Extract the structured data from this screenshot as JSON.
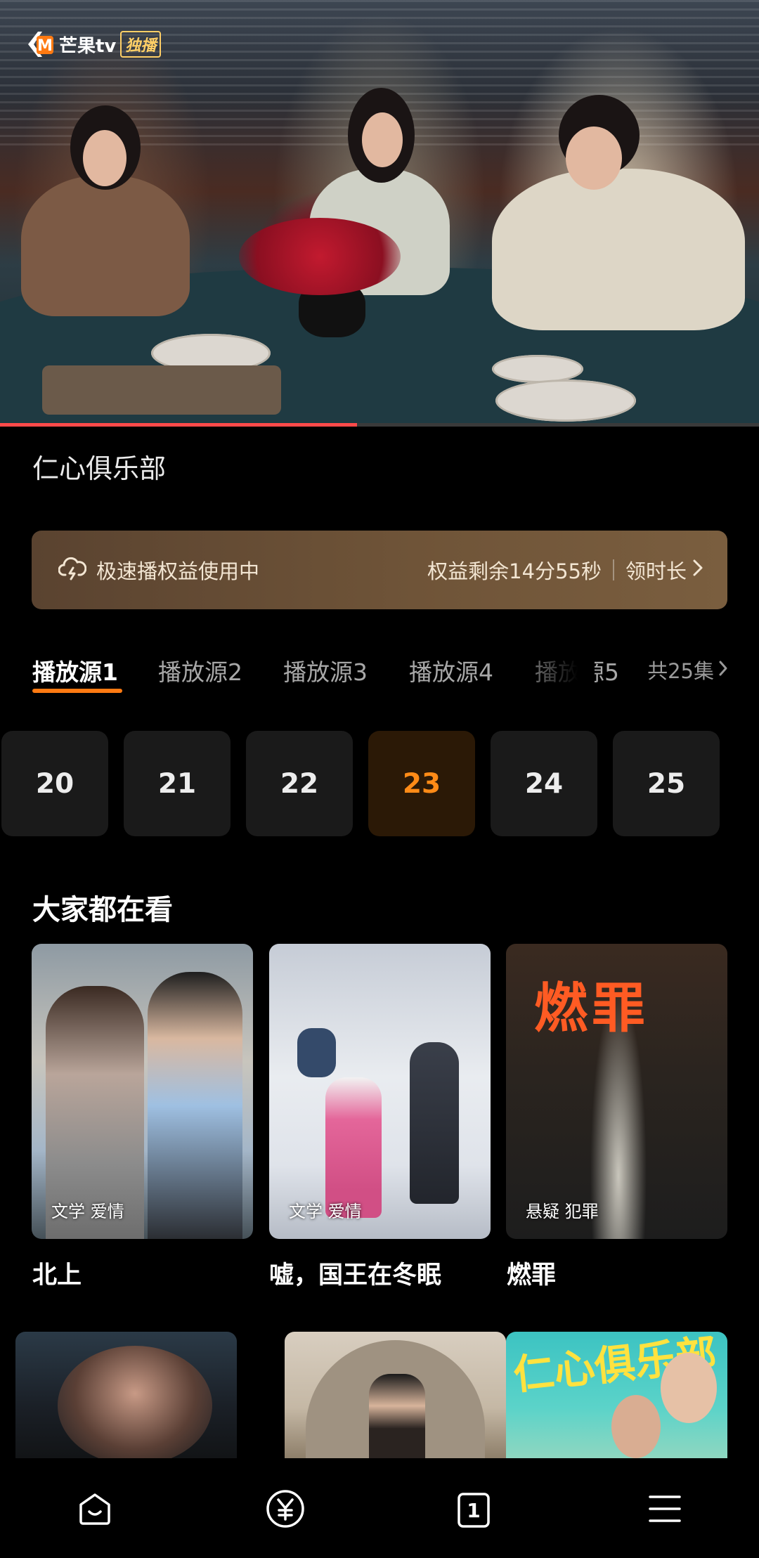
{
  "video": {
    "logo_text": "芒果tv",
    "logo_badge": "独播",
    "progress_fraction": 0.47
  },
  "show_title": "仁心俱乐部",
  "speed_banner": {
    "label": "极速播权益使用中",
    "remaining": "权益剩余14分55秒",
    "claim_label": "领时长"
  },
  "sources": {
    "tabs": [
      {
        "label": "播放源1"
      },
      {
        "label": "播放源2"
      },
      {
        "label": "播放源3"
      },
      {
        "label": "播放源4"
      },
      {
        "label": "播放源5"
      }
    ],
    "active_index": 0,
    "episodes_total": "共25集"
  },
  "episodes": {
    "items": [
      "20",
      "21",
      "22",
      "23",
      "24",
      "25"
    ],
    "current": "23"
  },
  "recommend": {
    "title": "大家都在看",
    "cards": [
      {
        "title": "北上",
        "genre": "文学 爱情"
      },
      {
        "title": "嘘，国王在冬眠",
        "genre": "文学 爱情"
      },
      {
        "title": "燃罪",
        "genre": "悬疑 犯罪",
        "poster_text": "燃罪"
      }
    ],
    "row2_poster_text": "仁心俱乐部"
  },
  "colors": {
    "accent": "#ff7a12",
    "progress": "#ff4a4a",
    "banner_bg": "#6f5438"
  },
  "nav": {
    "tab_count_badge": "1",
    "icons": [
      "home-icon",
      "yuan-icon",
      "tabs-icon",
      "menu-icon"
    ]
  }
}
